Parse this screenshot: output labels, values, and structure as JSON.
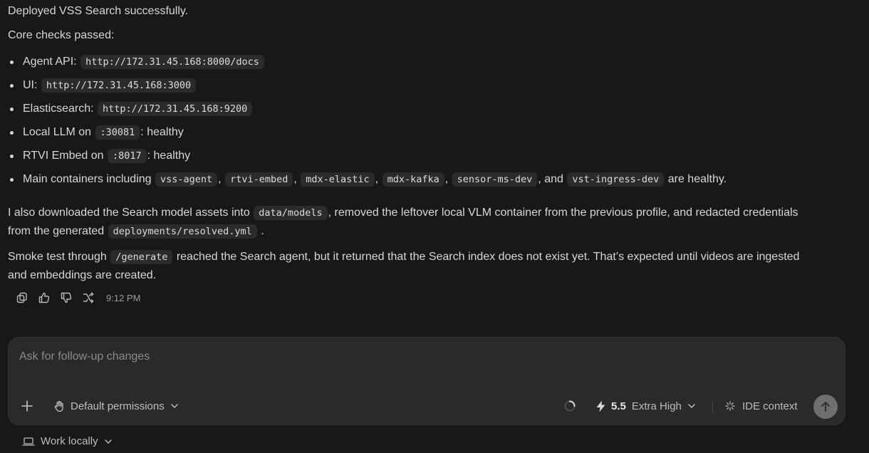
{
  "message": {
    "heading": "Deployed VSS Search successfully.",
    "checks_intro": "Core checks passed:",
    "bullets": [
      {
        "label": "Agent API:",
        "code": "http://172.31.45.168:8000/docs"
      },
      {
        "label": "UI:",
        "code": "http://172.31.45.168:3000"
      },
      {
        "label": "Elasticsearch:",
        "code": "http://172.31.45.168:9200"
      },
      {
        "label": "Local LLM on",
        "code": ":30081",
        "suffix": ": healthy"
      },
      {
        "label": "RTVI Embed on",
        "code": ":8017",
        "suffix": ": healthy"
      }
    ],
    "containers": {
      "prefix": "Main containers including",
      "items": [
        "vss-agent",
        "rtvi-embed",
        "mdx-elastic",
        "mdx-kafka",
        "sensor-ms-dev",
        "vst-ingress-dev"
      ],
      "sep": ",",
      "and": ", and",
      "suffix": "are healthy."
    },
    "para1": {
      "a": "I also downloaded the Search model assets into",
      "code1": "data/models",
      "b": ", removed the leftover local VLM container from the previous profile, and redacted credentials",
      "c": "from the generated",
      "code2": "deployments/resolved.yml",
      "d": "."
    },
    "para2": {
      "a": "Smoke test through",
      "code": "/generate",
      "b": "reached the Search agent, but it returned that the Search index does not exist yet. That’s expected until videos are ingested",
      "c": "and embeddings are created."
    },
    "time": "9:12 PM"
  },
  "composer": {
    "placeholder": "Ask for follow-up changes",
    "permissions_label": "Default permissions",
    "model_version": "5.5",
    "reasoning_label": "Extra High",
    "ide_context_label": "IDE context"
  },
  "footer": {
    "work_label": "Work locally"
  },
  "icons": {
    "copy": "copy-icon",
    "like": "thumbs-up-icon",
    "dislike": "thumbs-down-icon",
    "fork": "fork-icon",
    "add": "plus-icon",
    "hand": "hand-icon",
    "spinner": "spinner-icon",
    "bolt": "bolt-icon",
    "sparkle": "sparkle-icon",
    "send": "arrow-up-icon",
    "laptop": "laptop-icon",
    "chevron": "chevron-down-icon"
  },
  "colors": {
    "background": "#181818",
    "composer": "#2a2a2a",
    "code_bg": "#2b2b2b",
    "send": "#6f6f6f"
  }
}
